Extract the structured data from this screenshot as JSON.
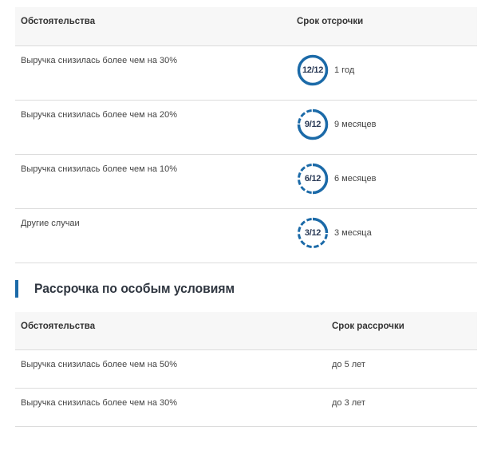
{
  "deferral_table": {
    "headers": {
      "conditions": "Обстоятельства",
      "period": "Срок отсрочки"
    },
    "rows": [
      {
        "condition": "Выручка снизилась более чем на 30%",
        "badge": "12/12",
        "months_filled": 12,
        "period": "1 год"
      },
      {
        "condition": "Выручка снизилась более чем на 20%",
        "badge": "9/12",
        "months_filled": 9,
        "period": "9 месяцев"
      },
      {
        "condition": "Выручка снизилась более чем на 10%",
        "badge": "6/12",
        "months_filled": 6,
        "period": "6 месяцев"
      },
      {
        "condition": "Другие случаи",
        "badge": "3/12",
        "months_filled": 3,
        "period": "3 месяца"
      }
    ]
  },
  "installment_section": {
    "title": "Рассрочка по особым условиям"
  },
  "installment_table": {
    "headers": {
      "conditions": "Обстоятельства",
      "period": "Срок рассрочки"
    },
    "rows": [
      {
        "condition": "Выручка снизилась более чем на 50%",
        "period": "до 5 лет"
      },
      {
        "condition": "Выручка снизилась более чем на 30%",
        "period": "до 3 лет"
      }
    ]
  },
  "colors": {
    "accent": "#1b6aa8",
    "header_bg": "#f7f7f7",
    "divider": "#dcdcdc"
  }
}
